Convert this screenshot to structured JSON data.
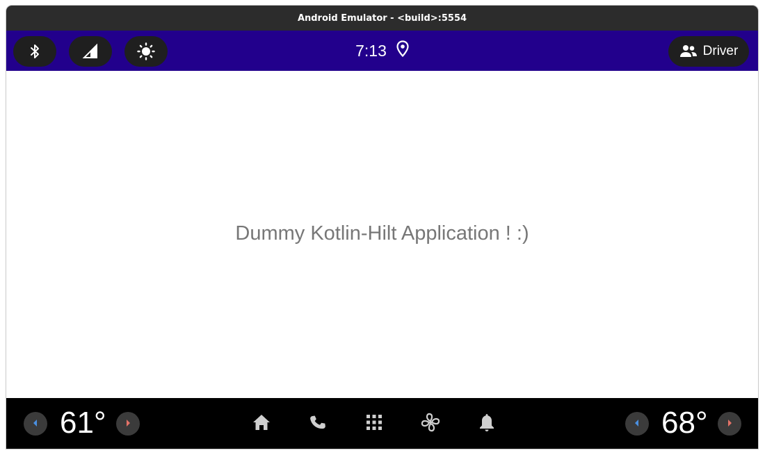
{
  "window": {
    "title": "Android Emulator - <build>:5554"
  },
  "status_bar": {
    "background_color": "#22008c",
    "quick_controls": [
      {
        "name": "bluetooth",
        "icon": "bluetooth-icon"
      },
      {
        "name": "signal",
        "icon": "cellular-signal-icon"
      },
      {
        "name": "brightness",
        "icon": "brightness-icon"
      }
    ],
    "clock": "7:13",
    "location_icon": "location-pin-icon",
    "profile": {
      "icon": "people-icon",
      "label": "Driver"
    }
  },
  "content": {
    "message": "Dummy Kotlin-Hilt Application ! :)"
  },
  "nav_bar": {
    "left_temperature": "61°",
    "right_temperature": "68°",
    "decrease_color": "#4a90e2",
    "increase_color": "#e57368",
    "icons": [
      "home-icon",
      "phone-icon",
      "app-grid-icon",
      "fan-icon",
      "bell-icon"
    ]
  }
}
